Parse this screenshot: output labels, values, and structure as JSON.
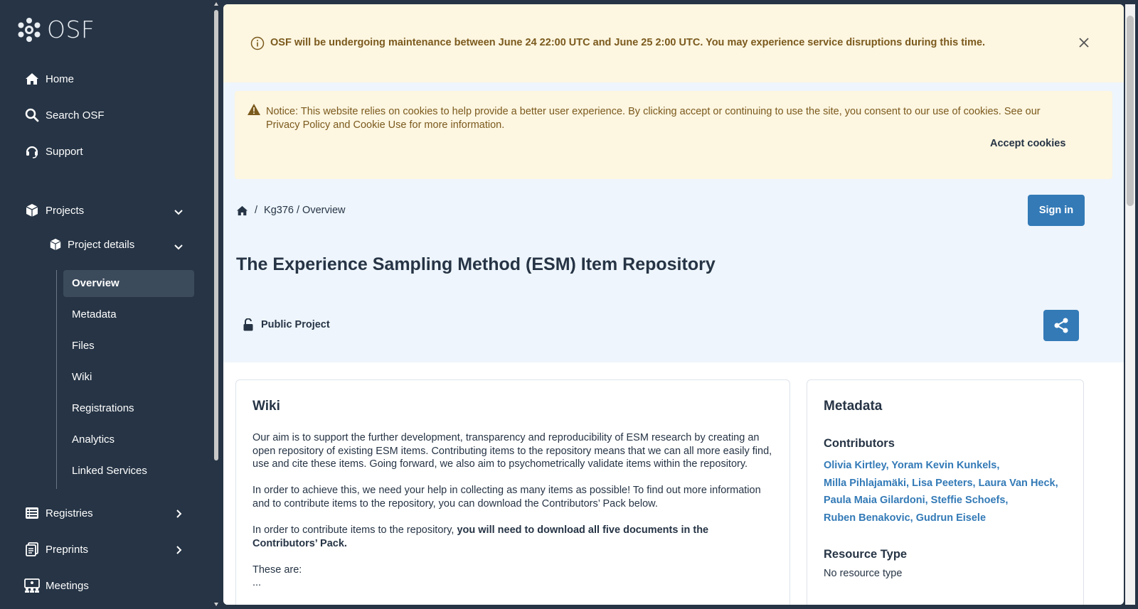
{
  "sidebar": {
    "logo_text": "OSF",
    "nav": {
      "home": "Home",
      "search": "Search OSF",
      "support": "Support",
      "projects": "Projects",
      "project_details": "Project details",
      "registries": "Registries",
      "preprints": "Preprints",
      "meetings": "Meetings"
    },
    "project_items": [
      "Overview",
      "Metadata",
      "Files",
      "Wiki",
      "Registrations",
      "Analytics",
      "Linked Services"
    ],
    "active_item": "Overview"
  },
  "banners": {
    "maintenance": "OSF will be undergoing maintenance between June 24 22:00 UTC and June 25 2:00 UTC. You may experience service disruptions during this time.",
    "cookie_notice": "Notice: This website relies on cookies to help provide a better user experience. By clicking accept or continuing to use the site, you consent to our use of cookies. See our Privacy Policy and Cookie Use for more information.",
    "accept_label": "Accept cookies"
  },
  "breadcrumb": {
    "separator": "/",
    "project": "Kg376 / Overview"
  },
  "header": {
    "sign_in": "Sign in",
    "title": "The Experience Sampling Method (ESM) Item Repository",
    "visibility": "Public Project"
  },
  "wiki": {
    "heading": "Wiki",
    "p1": "Our aim is to support the further development, transparency and reproducibility of ESM research by creating an open repository of existing ESM items. Contributing items to the repository means that we can all more easily find, use and cite these items. Going forward, we also aim to psychometrically validate items within the repository.",
    "p2": "In order to achieve this, we need your help in collecting as many items as possible! To find out more information and to contribute items to the repository, you can download the Contributors’ Pack below.",
    "p3_normal": "In order to contribute items to the repository, ",
    "p3_bold": "you will need to download all five documents in the Contributors’ Pack.",
    "p4": "These are:",
    "p5": "..."
  },
  "metadata": {
    "heading": "Metadata",
    "contributors_heading": "Contributors",
    "contributor_lines": [
      "Olivia Kirtley, Yoram Kevin Kunkels,",
      "Milla Pihlajamäki, Lisa Peeters, Laura Van Heck,",
      "Paula Maia Gilardoni, Steffie Schoefs,",
      "Ruben Benakovic, Gudrun Eisele"
    ],
    "resource_type_heading": "Resource Type",
    "resource_type_value": "No resource type"
  },
  "colors": {
    "sidebar_bg": "#263445",
    "banner_bg": "#fdf6e1",
    "banner_text": "#7b5a1d",
    "primary": "#337ab7",
    "page_bg": "#eef5fc"
  },
  "icons": [
    "osf-logo-icon",
    "home-icon",
    "search-icon",
    "headset-icon",
    "cube-icon",
    "chevron-down-icon",
    "chevron-right-icon",
    "registries-icon",
    "preprints-icon",
    "meetings-icon",
    "info-icon",
    "close-icon",
    "warning-icon",
    "lock-open-icon",
    "share-icon"
  ]
}
